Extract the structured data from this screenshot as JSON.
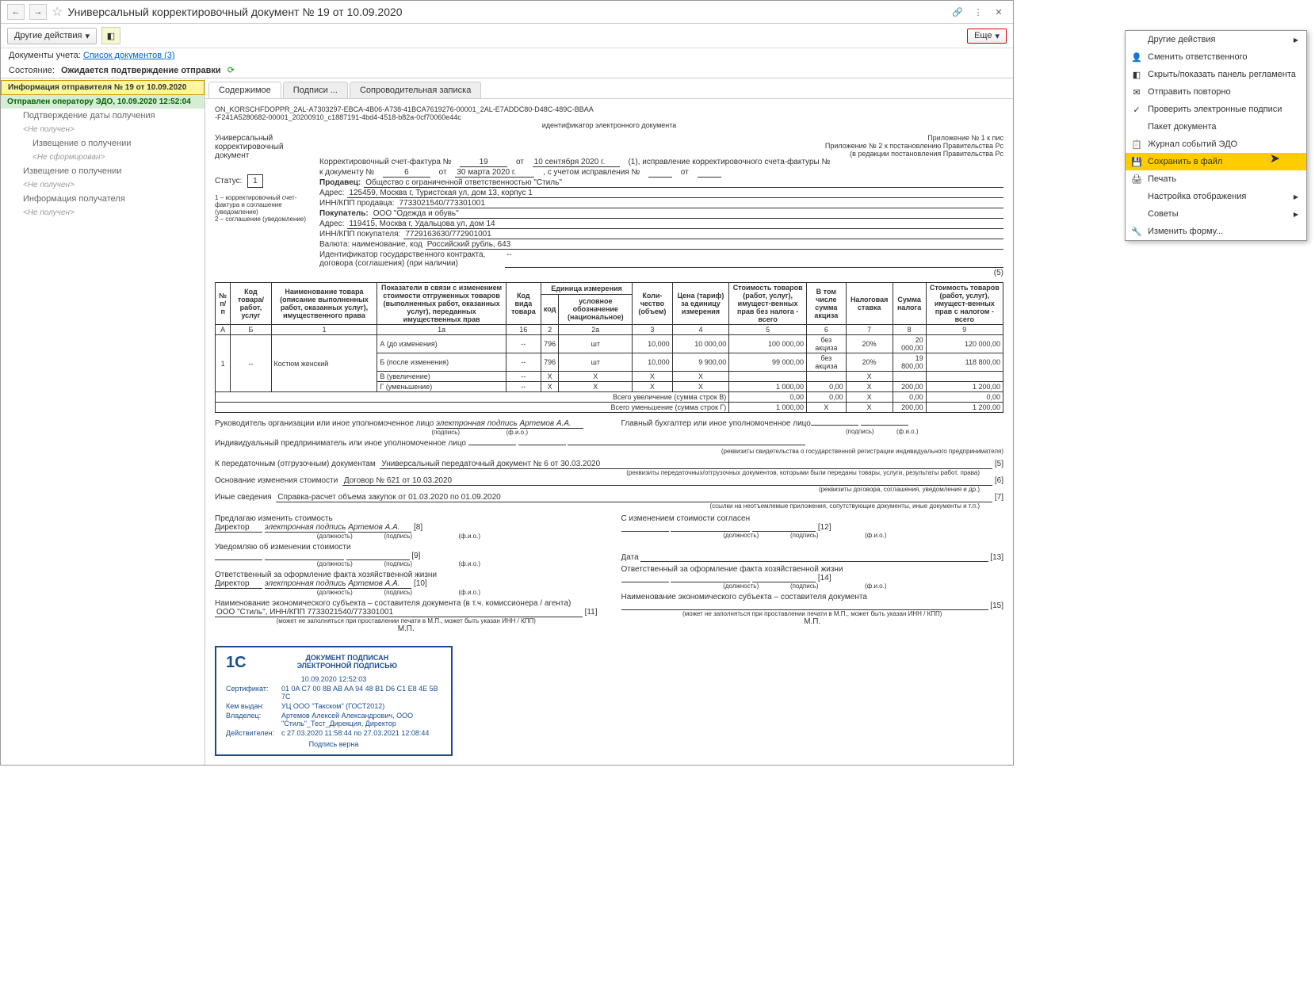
{
  "title": "Универсальный корректировочный документ № 19 от 10.09.2020",
  "toolbar": {
    "other_actions": "Другие действия",
    "more": "Еще"
  },
  "meta": {
    "docs_label": "Документы учета:",
    "docs_link": "Список документов (3)",
    "state_label": "Состояние:",
    "state_value": "Ожидается подтверждение отправки"
  },
  "sidebar": {
    "item1": "Информация отправителя № 19 от 10.09.2020",
    "item2": "Отправлен оператору ЭДО, 10.09.2020 12:52:04",
    "item3": "Подтверждение даты получения",
    "item3s": "<Не получен>",
    "item4": "Извещение о получении",
    "item4s": "<Не сформирован>",
    "item5": "Извещение о получении",
    "item5s": "<Не получен>",
    "item6": "Информация получателя",
    "item6s": "<Не получен>"
  },
  "tabs": {
    "t1": "Содержимое",
    "t2": "Подписи ...",
    "t3": "Сопроводительная записка"
  },
  "doc": {
    "id1": "ON_KORSCHFDOPPR_2AL-A7303297-EBCA-4B06-A738-41BCA7619276-00001_2AL-E7ADDC80-D48C-489C-BBAA",
    "id2": "-F241A5280682-00001_20200910_c1887191-4bd4-4518-b82a-0cf70060e44c",
    "id_label": "идентификатор электронного документа",
    "title_left": "Универсальный корректировочный документ",
    "app": "Приложение № 1 к пис",
    "app2": "Приложение № 2 к постановлению Правительства Рс",
    "app3": "(в редакции постановления Правительства Рс",
    "line1a": "Корректировочный счет-фактура №",
    "line1b": "19",
    "line1c": "от",
    "line1d": "10 сентября 2020 г.",
    "line1e": "(1), исправление корректировочного счета-фактуры №",
    "line2a": "к документу №",
    "line2b": "6",
    "line2c": "от",
    "line2d": "30 марта 2020 г.",
    "line2e": ", с учетом исправления №",
    "line2f": "от",
    "seller": "Продавец:",
    "seller_v": "Общество с ограниченной ответственностью \"Стиль\"",
    "addr": "Адрес:",
    "addr_v": "125459, Москва г, Туристская ул, дом 13, корпус 1",
    "inn1": "ИНН/КПП продавца:",
    "inn1_v": "7733021540/773301001",
    "buyer": "Покупатель:",
    "buyer_v": "ООО \"Одежда и обувь\"",
    "addr2_v": "119415, Москва г, Удальцова ул, дом 14",
    "inn2": "ИНН/КПП покупателя:",
    "inn2_v": "7729163630/772901001",
    "curr": "Валюта: наименование, код",
    "curr_v": "Российский рубль, 643",
    "contract": "Идентификатор государственного контракта, договора (соглашения) (при наличии)",
    "contract_v": "--",
    "status_label": "Статус:",
    "status_v": "1",
    "note1": "1 – корректировочный счет-фактура и соглашение (уведомление)",
    "note2": "2 – соглашение (уведомление)",
    "n5": "(5)"
  },
  "th": {
    "c1": "№ п/п",
    "c2": "Код товара/ работ, услуг",
    "c3": "Наименование товара (описание выполненных работ, оказанных услуг), имущественного права",
    "c4": "Показатели в связи с изменением стоимости отгруженных товаров (выполненных работ, оказанных услуг), переданных имущественных прав",
    "c5": "Код вида товара",
    "c6": "Единица измерения",
    "c6a": "код",
    "c6b": "условное обозначение (национальное)",
    "c7": "Коли-чество (объем)",
    "c8": "Цена (тариф) за единицу измерения",
    "c9": "Стоимость товаров (работ, услуг), имущест-венных прав без налога - всего",
    "c10": "В том числе сумма акциза",
    "c11": "Налоговая ставка",
    "c12": "Сумма налога",
    "c13": "Стоимость товаров (работ, услуг), имущест-венных прав с налогом - всего",
    "hA": "А",
    "hB": "Б",
    "h1": "1",
    "h1a": "1а",
    "h16": "16",
    "h2": "2",
    "h2a": "2а",
    "h3": "3",
    "h4": "4",
    "h5": "5",
    "h6": "6",
    "h7": "7",
    "h8": "8",
    "h9": "9"
  },
  "rows": {
    "r1_no": "1",
    "r1_code": "--",
    "r1_name": "Костюм женский",
    "r1a": "А (до изменения)",
    "r1a_c": "--",
    "r1a_k": "796",
    "r1a_u": "шт",
    "r1a_q": "10,000",
    "r1a_p": "10 000,00",
    "r1a_s": "100 000,00",
    "r1a_ak": "без акциза",
    "r1a_st": "20%",
    "r1a_n": "20 000,00",
    "r1a_t": "120 000,00",
    "r1b": "Б (после изменения)",
    "r1b_c": "--",
    "r1b_k": "796",
    "r1b_u": "шт",
    "r1b_q": "10,000",
    "r1b_p": "9 900,00",
    "r1b_s": "99 000,00",
    "r1b_ak": "без акциза",
    "r1b_st": "20%",
    "r1b_n": "19 800,00",
    "r1b_t": "118 800,00",
    "r1c": "В (увеличение)",
    "r1c_c": "--",
    "r1d": "Г (уменьшение)",
    "r1d_c": "--",
    "r1d_s": "1 000,00",
    "r1d_ak": "0,00",
    "r1d_n": "200,00",
    "r1d_t": "1 200,00",
    "sumB": "Всего увеличение (сумма строк В)",
    "sumB_s": "0,00",
    "sumB_ak": "0,00",
    "sumB_n": "0,00",
    "sumB_t": "0,00",
    "sumG": "Всего уменьшение (сумма строк Г)",
    "sumG_s": "1 000,00",
    "sumG_n": "200,00",
    "sumG_t": "1 200,00",
    "X": "Х"
  },
  "sig": {
    "head": "Руководитель организации или иное уполномоченное лицо",
    "esig": "электронная подпись",
    "artemov": "Артемов А.А.",
    "glav": "Главный бухгалтер или иное уполномоченное лицо",
    "podpis": "(подпись)",
    "fio": "(ф.и.о.)",
    "ip": "Индивидуальный предприниматель или иное уполномоченное лицо",
    "rekv": "(реквизиты свидетельства о государственной регистрации индивидуального предпринимателя)",
    "pered": "К передаточным (отгрузочным) документам",
    "pered_v": "Универсальный передаточный документ № 6 от 30.03.2020",
    "pered_r": "(реквизиты передаточных/отгрузочных документов, которыми были переданы товары, услуги, результаты работ, права)",
    "osn": "Основание изменения стоимости",
    "osn_v": "Договор № 621 от 10.03.2020",
    "osn_r": "(реквизиты договора, соглашения, уведомления и др.)",
    "other": "Иные сведения",
    "other_v": "Справка-расчет объема закупок от 01.03.2020 по 01.09.2020",
    "other_r": "(ссылки на неотъемлемые приложения, сопутствующие документы, иные документы и т.п.)",
    "predl": "Предлагаю изменить стоимость",
    "sogl": "С изменением стоимости согласен",
    "dir": "Директор",
    "dolzh": "(должность)",
    "uved": "Уведомляю об изменении стоимости",
    "date": "Дата",
    "otv": "Ответственный за оформление факта хозяйственной жизни",
    "naim": "Наименование экономического субъекта – составителя документа (в т.ч. комиссионера / агента)",
    "naim2": "Наименование экономического субъекта – составителя документа",
    "naim_v": "ООО \"Стиль\", ИНН/КПП 7733021540/773301001",
    "moget": "(может не заполняться при проставлении печати в М.П., может быть указан ИНН / КПП)",
    "mp": "М.П.",
    "n5": "[5]",
    "n6": "[6]",
    "n7": "[7]",
    "n8": "[8]",
    "n9": "[9]",
    "n10": "[10]",
    "n11": "[11]",
    "n12": "[12]",
    "n13": "[13]",
    "n14": "[14]",
    "n15": "[15]"
  },
  "stamp": {
    "t1": "ДОКУМЕНТ ПОДПИСАН",
    "t2": "ЭЛЕКТРОННОЙ ПОДПИСЬЮ",
    "date": "10.09.2020 12:52:03",
    "k1": "Сертификат:",
    "v1": "01 0A C7 00 8B AB AA 94 48 B1 D6 C1 E8 4E 5B 7C",
    "k2": "Кем выдан:",
    "v2": "УЦ ООО \"Такском\" (ГОСТ2012)",
    "k3": "Владелец:",
    "v3": "Артемов Алексей Александрович, ООО \"Стиль\"_Тест_Дирекция, Директор",
    "k4": "Действителен:",
    "v4": "с 27.03.2020 11:58:44 по 27.03.2021 12:08:44",
    "footer": "Подпись верна"
  },
  "menu": {
    "m1": "Другие действия",
    "m2": "Сменить ответственного",
    "m3": "Скрыть/показать панель регламента",
    "m4": "Отправить повторно",
    "m5": "Проверить электронные подписи",
    "m6": "Пакет документа",
    "m7": "Журнал событий ЭДО",
    "m8": "Сохранить в файл",
    "m9": "Печать",
    "m10": "Настройка отображения",
    "m11": "Советы",
    "m12": "Изменить форму..."
  }
}
